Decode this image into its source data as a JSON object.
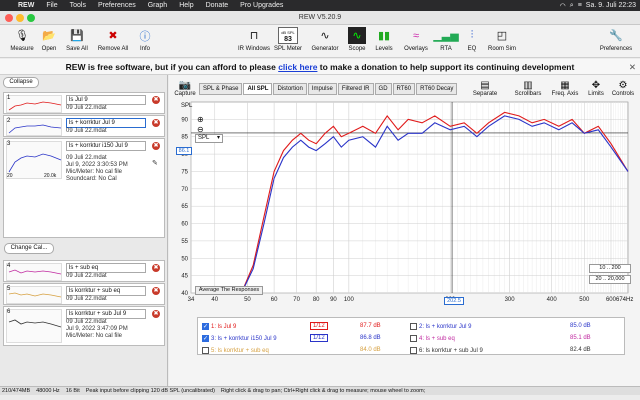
{
  "menubar": {
    "app": "REW",
    "items": [
      "File",
      "Tools",
      "Preferences",
      "Graph",
      "Help",
      "Donate",
      "Pro Upgrades"
    ],
    "clock": "Sa. 9. Juli  22:23"
  },
  "window": {
    "title": "REW V5.20.9"
  },
  "toolbar": {
    "measure": "Measure",
    "open": "Open",
    "save_all": "Save All",
    "remove_all": "Remove All",
    "info": "Info",
    "ir_windows": "IR Windows",
    "spl_meter": "SPL Meter",
    "spl_meter_value": "83",
    "spl_meter_unit": "dB SPL",
    "generator": "Generator",
    "scope": "Scope",
    "levels": "Levels",
    "overlays": "Overlays",
    "rta": "RTA",
    "eq": "EQ",
    "room_sim": "Room Sim",
    "preferences": "Preferences"
  },
  "banner": {
    "text_before": "REW is free software, but if you can afford to please ",
    "link": "click here",
    "text_after": " to make a donation to help support its continuing development"
  },
  "left": {
    "collapse": "Collapse",
    "change_cal": "Change Cal...",
    "measurements": [
      {
        "num": "1",
        "name": "ls Jul 9",
        "file": "09 Juli 22.mdat"
      },
      {
        "num": "2",
        "name": "ls + korrktur Jul 9",
        "file": "09 Juli 22.mdat"
      },
      {
        "num": "3",
        "name": "ls + korrktur i150 Jul 9",
        "file": "09 Juli 22.mdat",
        "file2": "Jul 9, 2022 3:30:53 PM",
        "file3": "Mic/Meter: No cal file",
        "file4": "Soundcard: No Cal",
        "axis_left": "20",
        "axis_right": "20.0k"
      },
      {
        "num": "4",
        "name": "ls + sub eq",
        "file": "09 Juli 22.mdat"
      },
      {
        "num": "5",
        "name": "ls korrktur + sub eq",
        "file": "09 Juli 22.mdat"
      },
      {
        "num": "6",
        "name": "ls korrktur + sub Jul 9",
        "file": "09 Juli 22.mdat",
        "file2": "Jul 9, 2022 3:47:09 PM",
        "file3": "Mic/Meter: No cal file"
      }
    ]
  },
  "graph": {
    "tabs": [
      "SPL & Phase",
      "All SPL",
      "Distortion",
      "Impulse",
      "Filtered IR",
      "GD",
      "RT60",
      "RT60 Decay"
    ],
    "active_tab": "All SPL",
    "capture": "Capture",
    "tools": [
      "Separate",
      "Scrollbars",
      "Freq. Axis",
      "Limits",
      "Controls"
    ],
    "unit_label": "SPL",
    "dropdown": "SPL",
    "cursor_value": "86.1",
    "cursor_freq": "202.5",
    "avg_btn": "Average The Responses",
    "range_btn1": "10 .. 200",
    "range_btn2": "20 .. 20,000",
    "x_end_label": "674Hz"
  },
  "chart_data": {
    "type": "line",
    "xlabel": "",
    "ylabel": "SPL",
    "xlim": [
      34,
      674
    ],
    "ylim": [
      40,
      95
    ],
    "x_scale": "log",
    "y_ticks": [
      40,
      45,
      50,
      55,
      60,
      65,
      70,
      75,
      80,
      85,
      90
    ],
    "x_ticks": [
      {
        "v": 34,
        "l": "34"
      },
      {
        "v": 40,
        "l": "40"
      },
      {
        "v": 50,
        "l": "50"
      },
      {
        "v": 60,
        "l": "60"
      },
      {
        "v": 70,
        "l": "70"
      },
      {
        "v": 80,
        "l": "80"
      },
      {
        "v": 90,
        "l": "90"
      },
      {
        "v": 100,
        "l": "100"
      },
      {
        "v": 200,
        "l": "200"
      },
      {
        "v": 300,
        "l": "300"
      },
      {
        "v": 400,
        "l": "400"
      },
      {
        "v": 500,
        "l": "500"
      },
      {
        "v": 600,
        "l": "600"
      }
    ],
    "grid": true,
    "series": [
      {
        "name": "1: ls Jul 9",
        "color": "#e01a1a",
        "x": [
          48,
          52,
          56,
          60,
          64,
          68,
          72,
          76,
          80,
          85,
          90,
          95,
          100,
          110,
          120,
          130,
          140,
          150,
          165,
          180,
          200,
          220,
          240,
          260,
          290,
          320,
          350,
          380,
          420,
          460,
          500,
          550,
          600,
          674
        ],
        "y": [
          40,
          48,
          62,
          75,
          81,
          84,
          86,
          84,
          83,
          86,
          88,
          85,
          86,
          88,
          86,
          91,
          87,
          90,
          89,
          91,
          88,
          89,
          86,
          89,
          92,
          91,
          89,
          90,
          88,
          90,
          86,
          88,
          83,
          75
        ]
      },
      {
        "name": "3: ls + korrktur i150 Jul 9",
        "color": "#2a34c8",
        "x": [
          48,
          52,
          56,
          60,
          64,
          68,
          72,
          76,
          80,
          85,
          90,
          95,
          100,
          110,
          120,
          130,
          140,
          150,
          165,
          180,
          200,
          220,
          240,
          260,
          290,
          320,
          350,
          380,
          420,
          460,
          500,
          550,
          600,
          674
        ],
        "y": [
          40,
          47,
          60,
          73,
          79,
          82,
          84,
          82,
          81,
          83,
          85,
          82,
          84,
          85,
          82,
          88,
          84,
          86,
          86,
          89,
          87,
          88,
          85,
          88,
          91,
          90,
          88,
          89,
          87,
          89,
          86,
          87,
          82,
          75
        ]
      }
    ],
    "legend": [
      {
        "label": "1: ls Jul 9",
        "smoothing": "1/12",
        "value": "87.7 dB",
        "checked": true,
        "color": "#e01a1a"
      },
      {
        "label": "2: ls + korrktur Jul 9",
        "smoothing": "",
        "value": "85.0 dB",
        "checked": false,
        "color": "#2a34c8"
      },
      {
        "label": "3: ls + korrktur i150 Jul 9",
        "smoothing": "1/12",
        "value": "86.8 dB",
        "checked": true,
        "color": "#2a34c8"
      },
      {
        "label": "4: ls + sub eq",
        "smoothing": "",
        "value": "85.1 dB",
        "checked": false,
        "color": "#c02aa0"
      },
      {
        "label": "5: ls korrktur + sub eq",
        "smoothing": "",
        "value": "84.0 dB",
        "checked": false,
        "color": "#d6a040"
      },
      {
        "label": "6: ls korrktur + sub Jul 9",
        "smoothing": "",
        "value": "82.4 dB",
        "checked": false,
        "color": "#333333"
      }
    ]
  },
  "status": {
    "mem": "210/474MB",
    "rate": "48000 Hz",
    "bits": "16 Bit",
    "message": "Peak input before clipping 120 dB SPL (uncalibrated)",
    "hint": "Right click & drag to pan; Ctrl+Right click & drag to measure; mouse wheel to zoom;"
  }
}
